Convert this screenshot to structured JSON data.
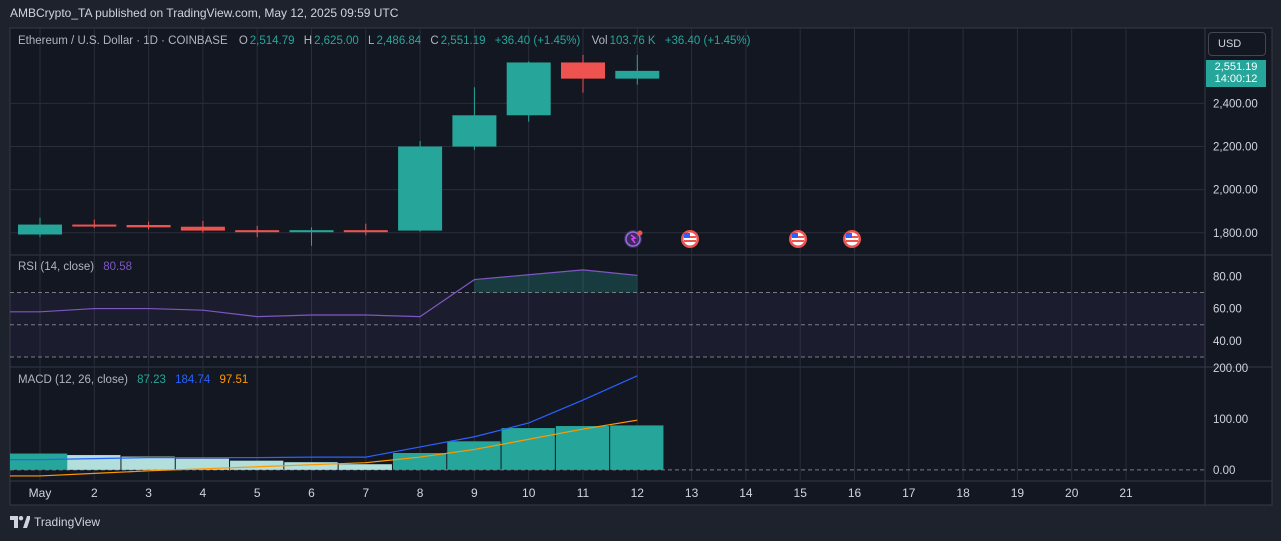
{
  "publisher_line": "AMBCrypto_TA published on TradingView.com, May 12, 2025 09:59 UTC",
  "footer": {
    "brand": "TradingView"
  },
  "header": {
    "symbol": "Ethereum / U.S. Dollar · 1D · COINBASE",
    "o_label": "O",
    "o_value": "2,514.79",
    "h_label": "H",
    "h_value": "2,625.00",
    "l_label": "L",
    "l_value": "2,486.84",
    "c_label": "C",
    "c_value": "2,551.19",
    "change": "+36.40 (+1.45%)",
    "vol_label": "Vol",
    "vol_value": "103.76 K",
    "vol_change": "+36.40 (+1.45%)"
  },
  "currency_button": "USD",
  "last_price": {
    "price": "2,551.19",
    "countdown": "14:00:12"
  },
  "rsi_legend": {
    "label": "RSI (14, close)",
    "value": "80.58"
  },
  "macd_legend": {
    "label": "MACD (12, 26, close)",
    "macd": "87.23",
    "signal": "184.74",
    "hist": "97.51"
  },
  "colors": {
    "background": "#1e222d",
    "up": "#26a69a",
    "down": "#ef5350",
    "rsi_line": "#7e57c2",
    "macd_line": "#2962ff",
    "signal_line": "#ff9800",
    "hist_light": "#b2dfdb"
  },
  "chart_data": [
    {
      "type": "candlestick",
      "title": "Ethereum / U.S. Dollar · 1D · COINBASE",
      "x": [
        "May",
        "2",
        "3",
        "4",
        "5",
        "6",
        "7",
        "8",
        "9",
        "10",
        "11",
        "12"
      ],
      "x_ticks": [
        "May",
        "2",
        "3",
        "4",
        "5",
        "6",
        "7",
        "8",
        "9",
        "10",
        "11",
        "12",
        "13",
        "14",
        "15",
        "16",
        "17",
        "18",
        "19",
        "20",
        "21"
      ],
      "open": [
        1792,
        1838,
        1836,
        1828,
        1812,
        1805,
        1812,
        1810,
        2200,
        2345,
        2590,
        2515
      ],
      "high": [
        1870,
        1861,
        1852,
        1855,
        1832,
        1825,
        1842,
        2225,
        2475,
        2595,
        2625,
        2625
      ],
      "low": [
        1780,
        1822,
        1815,
        1800,
        1780,
        1740,
        1788,
        1805,
        2185,
        2315,
        2450,
        2487
      ],
      "close": [
        1838,
        1836,
        1825,
        1810,
        1805,
        1812,
        1810,
        2200,
        2345,
        2590,
        2515,
        2551
      ],
      "y_ticks": [
        "2,400.00",
        "2,200.00",
        "2,000.00",
        "1,800.00"
      ],
      "ylim": [
        1720,
        2620
      ]
    },
    {
      "type": "line",
      "title": "RSI (14, close)",
      "x": [
        "May",
        "2",
        "3",
        "4",
        "5",
        "6",
        "7",
        "8",
        "9",
        "10",
        "11",
        "12"
      ],
      "values": [
        58,
        60,
        60,
        59,
        55,
        56,
        56,
        55,
        78,
        81,
        84,
        80.58
      ],
      "bands": [
        70,
        50,
        30
      ],
      "y_ticks": [
        "80.00",
        "60.00",
        "40.00"
      ],
      "ylim": [
        25,
        92
      ]
    },
    {
      "type": "bar",
      "title": "MACD (12, 26, close)",
      "x": [
        "May",
        "2",
        "3",
        "4",
        "5",
        "6",
        "7",
        "8",
        "9",
        "10",
        "11",
        "12"
      ],
      "series": [
        {
          "name": "MACD",
          "values": [
            20,
            22,
            24,
            24,
            24,
            25,
            25,
            45,
            65,
            92,
            137,
            184.74
          ]
        },
        {
          "name": "Signal",
          "values": [
            -12,
            -7,
            -2,
            2,
            6,
            10,
            14,
            25,
            40,
            60,
            80,
            97.51
          ]
        },
        {
          "name": "Histogram",
          "values": [
            32,
            29,
            26,
            22,
            18,
            15,
            11,
            33,
            56,
            82,
            86,
            87.23
          ]
        }
      ],
      "y_ticks": [
        "200.00",
        "100.00",
        "0.00"
      ],
      "ylim": [
        -20,
        200
      ]
    }
  ]
}
